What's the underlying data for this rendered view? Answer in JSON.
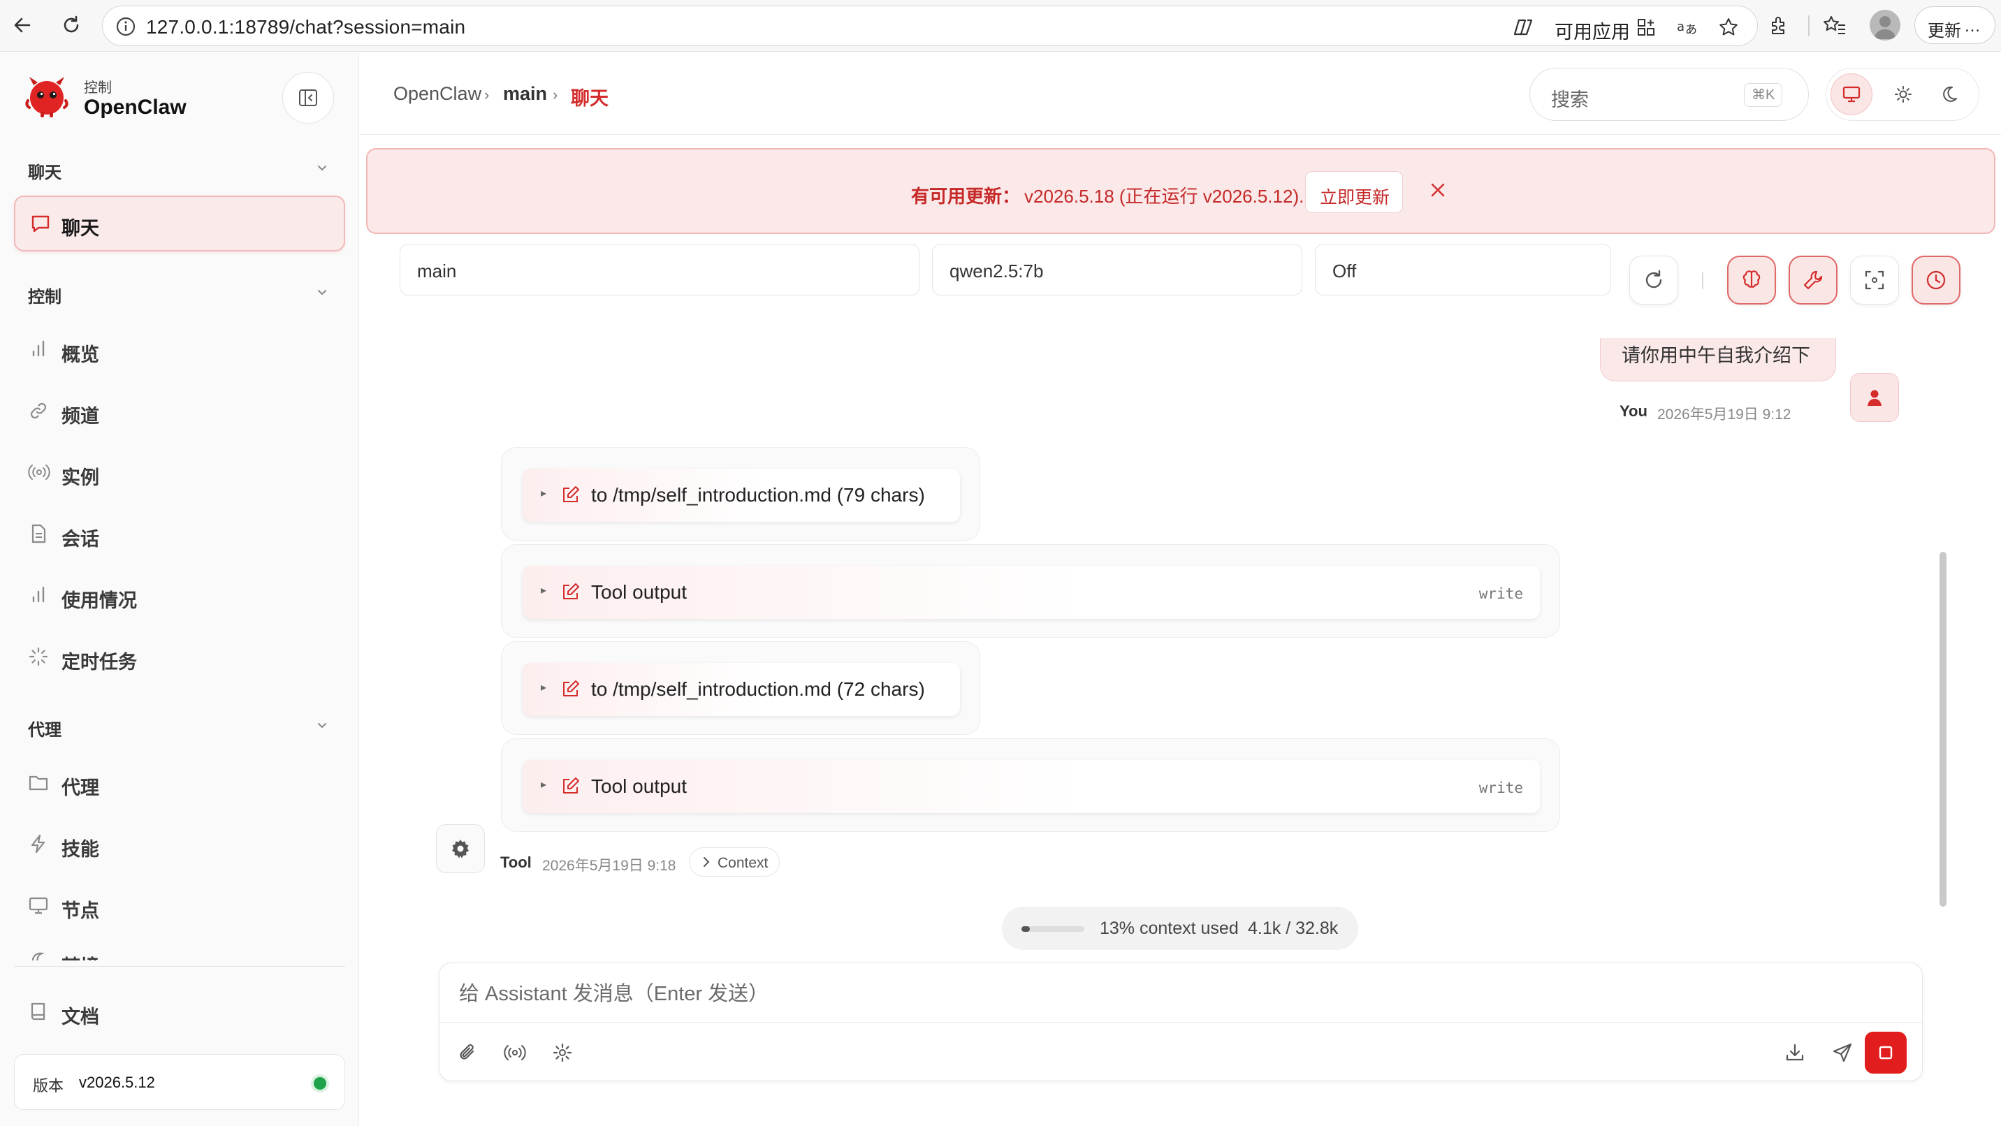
{
  "browser": {
    "url": "127.0.0.1:18789/chat?session=main",
    "available_app": "可用应用",
    "update_label": "更新"
  },
  "sidebar": {
    "brand_sub": "控制",
    "brand_name": "OpenClaw",
    "sections": {
      "chat": "聊天",
      "control": "控制",
      "agent": "代理"
    },
    "active_item": "聊天",
    "control_items": [
      "概览",
      "频道",
      "实例",
      "会话",
      "使用情况",
      "定时任务"
    ],
    "agent_items": [
      "代理",
      "技能",
      "节点",
      "梦境"
    ],
    "docs": "文档",
    "version_label": "版本",
    "version_value": "v2026.5.12",
    "status_color": "#1fa34a"
  },
  "header": {
    "breadcrumb_root": "OpenClaw",
    "breadcrumb_session": "main",
    "breadcrumb_current": "聊天",
    "search_placeholder": "搜索",
    "search_shortcut": "⌘K"
  },
  "banner": {
    "title": "有可用更新：",
    "detail": "v2026.5.18 (正在运行 v2026.5.12).",
    "button": "立即更新"
  },
  "controls": {
    "session": "main",
    "model": "qwen2.5:7b",
    "thinking": "Off"
  },
  "chat": {
    "user_message": "请你用中午自我介绍下",
    "user_name": "You",
    "user_time": "2026年5月19日 9:12",
    "tool_rows": [
      {
        "text": "to /tmp/self_introduction.md (79 chars)",
        "tag": ""
      },
      {
        "text": "Tool output",
        "tag": "write"
      },
      {
        "text": "to /tmp/self_introduction.md (72 chars)",
        "tag": ""
      },
      {
        "text": "Tool output",
        "tag": "write"
      }
    ],
    "tool_name": "Tool",
    "tool_time": "2026年5月19日 9:18",
    "context_chip": "Context"
  },
  "context_usage": {
    "percent_text": "13% context used",
    "tokens_text": "4.1k / 32.8k",
    "fraction": 0.13
  },
  "composer": {
    "placeholder": "给 Assistant 发消息（Enter 发送）"
  },
  "colors": {
    "accent": "#d42b2b",
    "accent_soft": "#fbe8e8",
    "stop_button": "#e11d1d"
  }
}
